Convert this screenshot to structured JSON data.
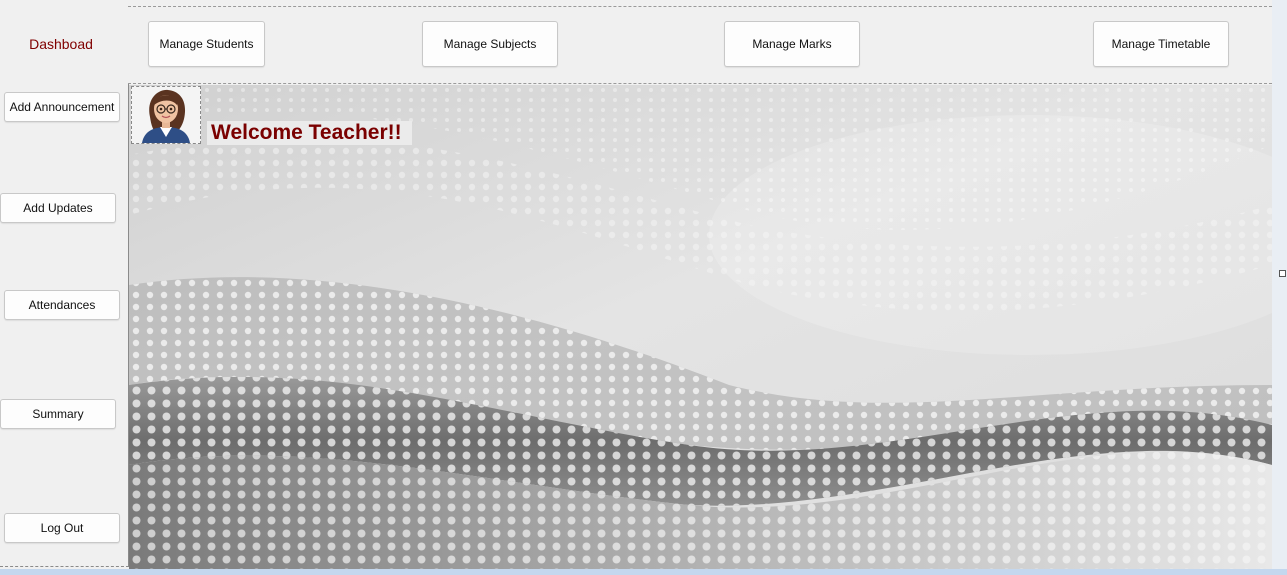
{
  "sidebar": {
    "title": "Dashboad",
    "buttons": [
      {
        "label": "Add Announcement"
      },
      {
        "label": "Add Updates"
      },
      {
        "label": "Attendances"
      },
      {
        "label": "Summary"
      },
      {
        "label": "Log Out"
      }
    ]
  },
  "topbar": {
    "buttons": [
      {
        "label": "Manage Students"
      },
      {
        "label": "Manage Subjects"
      },
      {
        "label": "Manage Marks"
      },
      {
        "label": "Manage Timetable"
      }
    ]
  },
  "main": {
    "welcome_text": "Welcome Teacher!!",
    "avatar_icon": "teacher-avatar-icon",
    "background_image": "halftone-wave-background"
  },
  "colors": {
    "title": "#800000",
    "welcome": "#7a0000",
    "form_background": "#f0f0f0"
  }
}
